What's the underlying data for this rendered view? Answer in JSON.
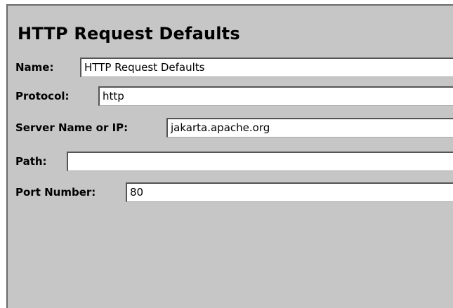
{
  "panel": {
    "title": "HTTP Request Defaults"
  },
  "fields": {
    "name": {
      "label": "Name:",
      "value": "HTTP Request Defaults"
    },
    "protocol": {
      "label": "Protocol:",
      "value": "http"
    },
    "server": {
      "label": "Server Name or IP:",
      "value": "jakarta.apache.org"
    },
    "path": {
      "label": "Path:",
      "value": ""
    },
    "port": {
      "label": "Port Number:",
      "value": "80"
    }
  }
}
